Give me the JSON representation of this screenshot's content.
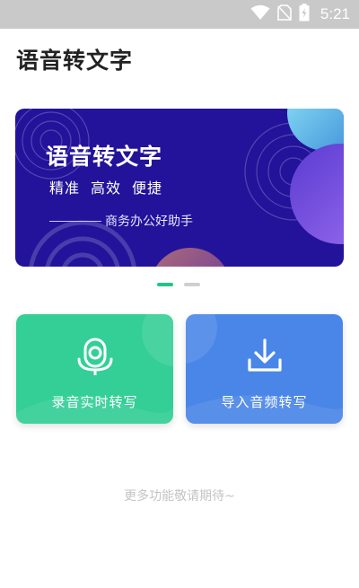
{
  "status_bar": {
    "time": "5:21",
    "icons": [
      "wifi-icon",
      "no-sim-icon",
      "battery-charging-icon"
    ]
  },
  "header": {
    "title": "语音转文字"
  },
  "banner": {
    "title": "语音转文字",
    "tags": [
      "精准",
      "高效",
      "便捷"
    ],
    "subtitle": "商务办公好助手",
    "colors": {
      "background": "#22139a",
      "accent_blue": "#6fd3f0",
      "accent_purple": "#7a52e0",
      "accent_orange": "#c87a7a"
    }
  },
  "carousel": {
    "total": 2,
    "active_index": 0,
    "active_color": "#22c48a"
  },
  "actions": {
    "record": {
      "label": "录音实时转写",
      "icon": "microphone-icon",
      "color": "#34cf96"
    },
    "import": {
      "label": "导入音频转写",
      "icon": "download-icon",
      "color": "#4a86e8"
    }
  },
  "footer": {
    "more_text": "更多功能敬请期待~"
  }
}
